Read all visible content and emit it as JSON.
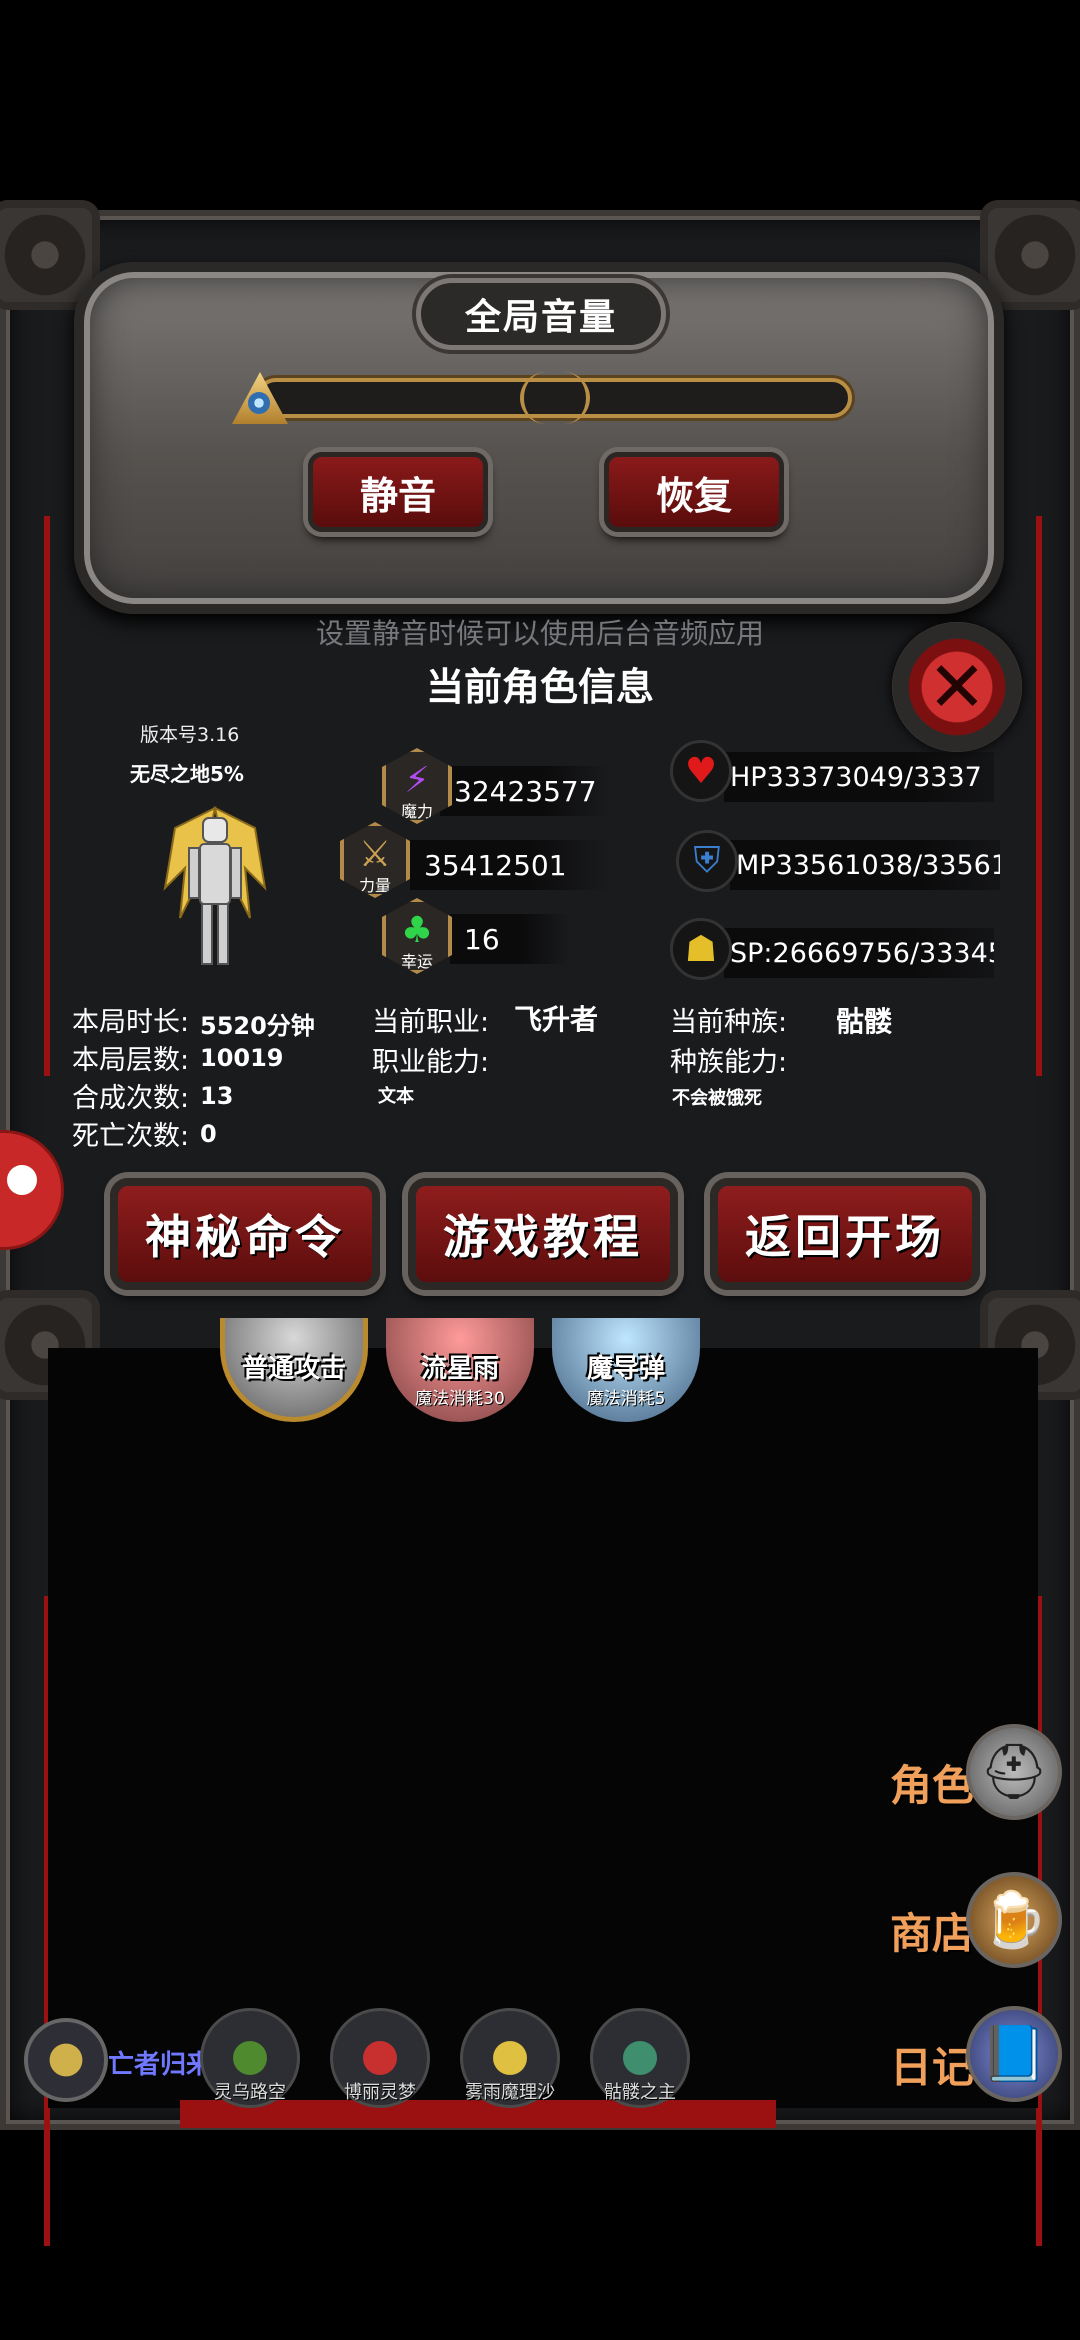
{
  "volume": {
    "title": "全局音量",
    "mute_label": "静音",
    "restore_label": "恢复",
    "hint": "设置静音时候可以使用后台音频应用"
  },
  "character": {
    "title": "当前角色信息",
    "version": "版本号3.16",
    "area": "无尽之地5%",
    "stats": {
      "magic": {
        "value": "32423577",
        "label": "魔力"
      },
      "strength": {
        "value": "35412501",
        "label": "力量"
      },
      "luck": {
        "value": "16",
        "label": "幸运"
      }
    },
    "resources": {
      "hp": "HP33373049/3337",
      "mp": "MP33561038/33561",
      "sp": "SP:26669756/33345"
    },
    "session": {
      "duration_label": "本局时长:",
      "duration_value": "5520分钟",
      "floors_label": "本局层数:",
      "floors_value": "10019",
      "crafts_label": "合成次数:",
      "crafts_value": "13",
      "deaths_label": "死亡次数:",
      "deaths_value": "0"
    },
    "job": {
      "label": "当前职业:",
      "value": "飞升者",
      "ability_label": "职业能力:",
      "ability_value": "文本"
    },
    "race": {
      "label": "当前种族:",
      "value": "骷髅",
      "ability_label": "种族能力:",
      "ability_value": "不会被饿死"
    }
  },
  "actions": {
    "secret_command": "神秘命令",
    "tutorial": "游戏教程",
    "return_start": "返回开场"
  },
  "skills": [
    {
      "name": "普通攻击",
      "cost": ""
    },
    {
      "name": "流星雨",
      "cost": "魔法消耗30"
    },
    {
      "name": "魔导弹",
      "cost": "魔法消耗5"
    }
  ],
  "menu": {
    "character": "角色",
    "shop": "商店",
    "diary": "日记"
  },
  "party": {
    "leader": "亡者归来",
    "members": [
      "灵乌路空",
      "博丽灵梦",
      "雾雨魔理沙",
      "骷髅之主"
    ]
  },
  "icons": {
    "magic": "lightning-icon",
    "strength": "sword-icon",
    "luck": "clover-icon",
    "hp": "heart-icon",
    "mp": "armor-icon",
    "sp": "muscle-icon",
    "close": "close-icon",
    "character_menu": "helmet-icon",
    "shop_menu": "beer-mug-icon",
    "diary_menu": "book-icon"
  },
  "colors": {
    "accent_red": "#8a1a1a",
    "menu_text": "#f0a05a",
    "leader_name": "#6f78ff"
  }
}
